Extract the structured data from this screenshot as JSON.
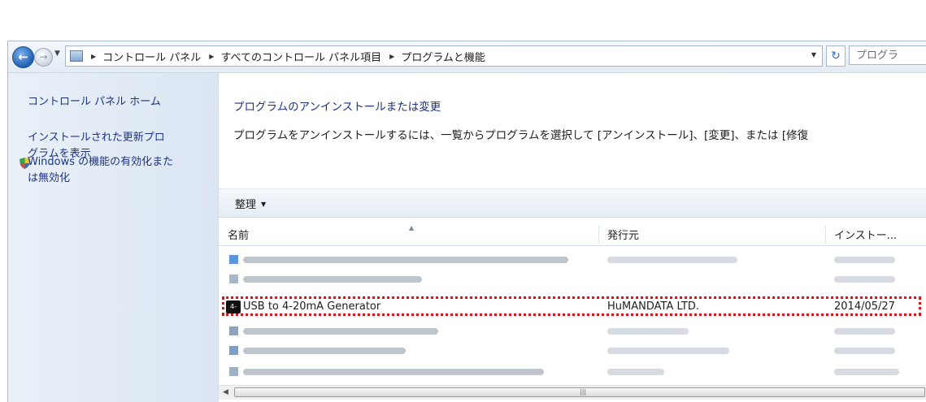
{
  "nav": {
    "back_icon": "back-arrow-icon",
    "forward_icon": "forward-arrow-icon",
    "breadcrumbs": [
      "コントロール パネル",
      "すべてのコントロール パネル項目",
      "プログラムと機能"
    ],
    "search_placeholder": "プログラ"
  },
  "sidebar": {
    "home_link": "コントロール パネル ホーム",
    "updates_link_line1": "インストールされた更新プロ",
    "updates_link_line2": "グラムを表示",
    "features_link_line1": "Windows の機能の有効化また",
    "features_link_line2": "は無効化"
  },
  "main": {
    "title": "プログラムのアンインストールまたは変更",
    "description": "プログラムをアンインストールするには、一覧からプログラムを選択して [アンインストール]、[変更]、または [修復"
  },
  "toolbar": {
    "organize_label": "整理"
  },
  "table": {
    "columns": [
      "名前",
      "発行元",
      "インストー..."
    ],
    "highlighted_row": {
      "name": "USB to 4-20mA Generator",
      "publisher": "HuMANDATA LTD.",
      "installed": "2014/05/27",
      "icon_label": "4-20"
    }
  },
  "colors": {
    "link": "#1e3287",
    "highlight_outline": "#d0161e",
    "sidebar_bg": "#e3ecf6"
  }
}
